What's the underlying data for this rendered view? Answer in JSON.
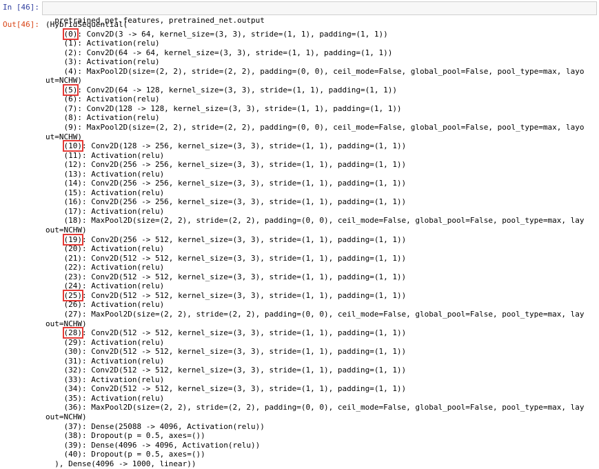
{
  "input": {
    "prompt": "In [46]:",
    "code": "pretrained_net.features, pretrained_net.output"
  },
  "output": {
    "prompt": "Out[46]:",
    "lines": [
      {
        "t": "(HybridSequential("
      },
      {
        "i": "    ",
        "h": "(0)",
        "t": ": Conv2D(3 -> 64, kernel_size=(3, 3), stride=(1, 1), padding=(1, 1))"
      },
      {
        "t": "    (1): Activation(relu)"
      },
      {
        "t": "    (2): Conv2D(64 -> 64, kernel_size=(3, 3), stride=(1, 1), padding=(1, 1))"
      },
      {
        "t": "    (3): Activation(relu)"
      },
      {
        "t": "    (4): MaxPool2D(size=(2, 2), stride=(2, 2), padding=(0, 0), ceil_mode=False, global_pool=False, pool_type=max, layo"
      },
      {
        "t": "ut=NCHW)"
      },
      {
        "i": "    ",
        "h": "(5)",
        "t": ": Conv2D(64 -> 128, kernel_size=(3, 3), stride=(1, 1), padding=(1, 1))"
      },
      {
        "t": "    (6): Activation(relu)"
      },
      {
        "t": "    (7): Conv2D(128 -> 128, kernel_size=(3, 3), stride=(1, 1), padding=(1, 1))"
      },
      {
        "t": "    (8): Activation(relu)"
      },
      {
        "t": "    (9): MaxPool2D(size=(2, 2), stride=(2, 2), padding=(0, 0), ceil_mode=False, global_pool=False, pool_type=max, layo"
      },
      {
        "t": "ut=NCHW)"
      },
      {
        "i": "    ",
        "h": "(10)",
        "t": ": Conv2D(128 -> 256, kernel_size=(3, 3), stride=(1, 1), padding=(1, 1))"
      },
      {
        "t": "    (11): Activation(relu)"
      },
      {
        "t": "    (12): Conv2D(256 -> 256, kernel_size=(3, 3), stride=(1, 1), padding=(1, 1))"
      },
      {
        "t": "    (13): Activation(relu)"
      },
      {
        "t": "    (14): Conv2D(256 -> 256, kernel_size=(3, 3), stride=(1, 1), padding=(1, 1))"
      },
      {
        "t": "    (15): Activation(relu)"
      },
      {
        "t": "    (16): Conv2D(256 -> 256, kernel_size=(3, 3), stride=(1, 1), padding=(1, 1))"
      },
      {
        "t": "    (17): Activation(relu)"
      },
      {
        "t": "    (18): MaxPool2D(size=(2, 2), stride=(2, 2), padding=(0, 0), ceil_mode=False, global_pool=False, pool_type=max, lay"
      },
      {
        "t": "out=NCHW)"
      },
      {
        "i": "    ",
        "h": "(19)",
        "t": ": Conv2D(256 -> 512, kernel_size=(3, 3), stride=(1, 1), padding=(1, 1))"
      },
      {
        "t": "    (20): Activation(relu)"
      },
      {
        "t": "    (21): Conv2D(512 -> 512, kernel_size=(3, 3), stride=(1, 1), padding=(1, 1))"
      },
      {
        "t": "    (22): Activation(relu)"
      },
      {
        "t": "    (23): Conv2D(512 -> 512, kernel_size=(3, 3), stride=(1, 1), padding=(1, 1))"
      },
      {
        "t": "    (24): Activation(relu)"
      },
      {
        "i": "    ",
        "h": "(25)",
        "t": ": Conv2D(512 -> 512, kernel_size=(3, 3), stride=(1, 1), padding=(1, 1))"
      },
      {
        "t": "    (26): Activation(relu)"
      },
      {
        "t": "    (27): MaxPool2D(size=(2, 2), stride=(2, 2), padding=(0, 0), ceil_mode=False, global_pool=False, pool_type=max, lay"
      },
      {
        "t": "out=NCHW)"
      },
      {
        "i": "    ",
        "h": "(28)",
        "t": ": Conv2D(512 -> 512, kernel_size=(3, 3), stride=(1, 1), padding=(1, 1))"
      },
      {
        "t": "    (29): Activation(relu)"
      },
      {
        "t": "    (30): Conv2D(512 -> 512, kernel_size=(3, 3), stride=(1, 1), padding=(1, 1))"
      },
      {
        "t": "    (31): Activation(relu)"
      },
      {
        "t": "    (32): Conv2D(512 -> 512, kernel_size=(3, 3), stride=(1, 1), padding=(1, 1))"
      },
      {
        "t": "    (33): Activation(relu)"
      },
      {
        "t": "    (34): Conv2D(512 -> 512, kernel_size=(3, 3), stride=(1, 1), padding=(1, 1))"
      },
      {
        "t": "    (35): Activation(relu)"
      },
      {
        "t": "    (36): MaxPool2D(size=(2, 2), stride=(2, 2), padding=(0, 0), ceil_mode=False, global_pool=False, pool_type=max, lay"
      },
      {
        "t": "out=NCHW)"
      },
      {
        "t": "    (37): Dense(25088 -> 4096, Activation(relu))"
      },
      {
        "t": "    (38): Dropout(p = 0.5, axes=())"
      },
      {
        "t": "    (39): Dense(4096 -> 4096, Activation(relu))"
      },
      {
        "t": "    (40): Dropout(p = 0.5, axes=())"
      },
      {
        "t": "  ), Dense(4096 -> 1000, linear))"
      }
    ]
  },
  "colors": {
    "in_prompt": "#303f9f",
    "out_prompt": "#d84315",
    "highlight_box": "#e53935",
    "input_bg": "#f7f7f7"
  }
}
